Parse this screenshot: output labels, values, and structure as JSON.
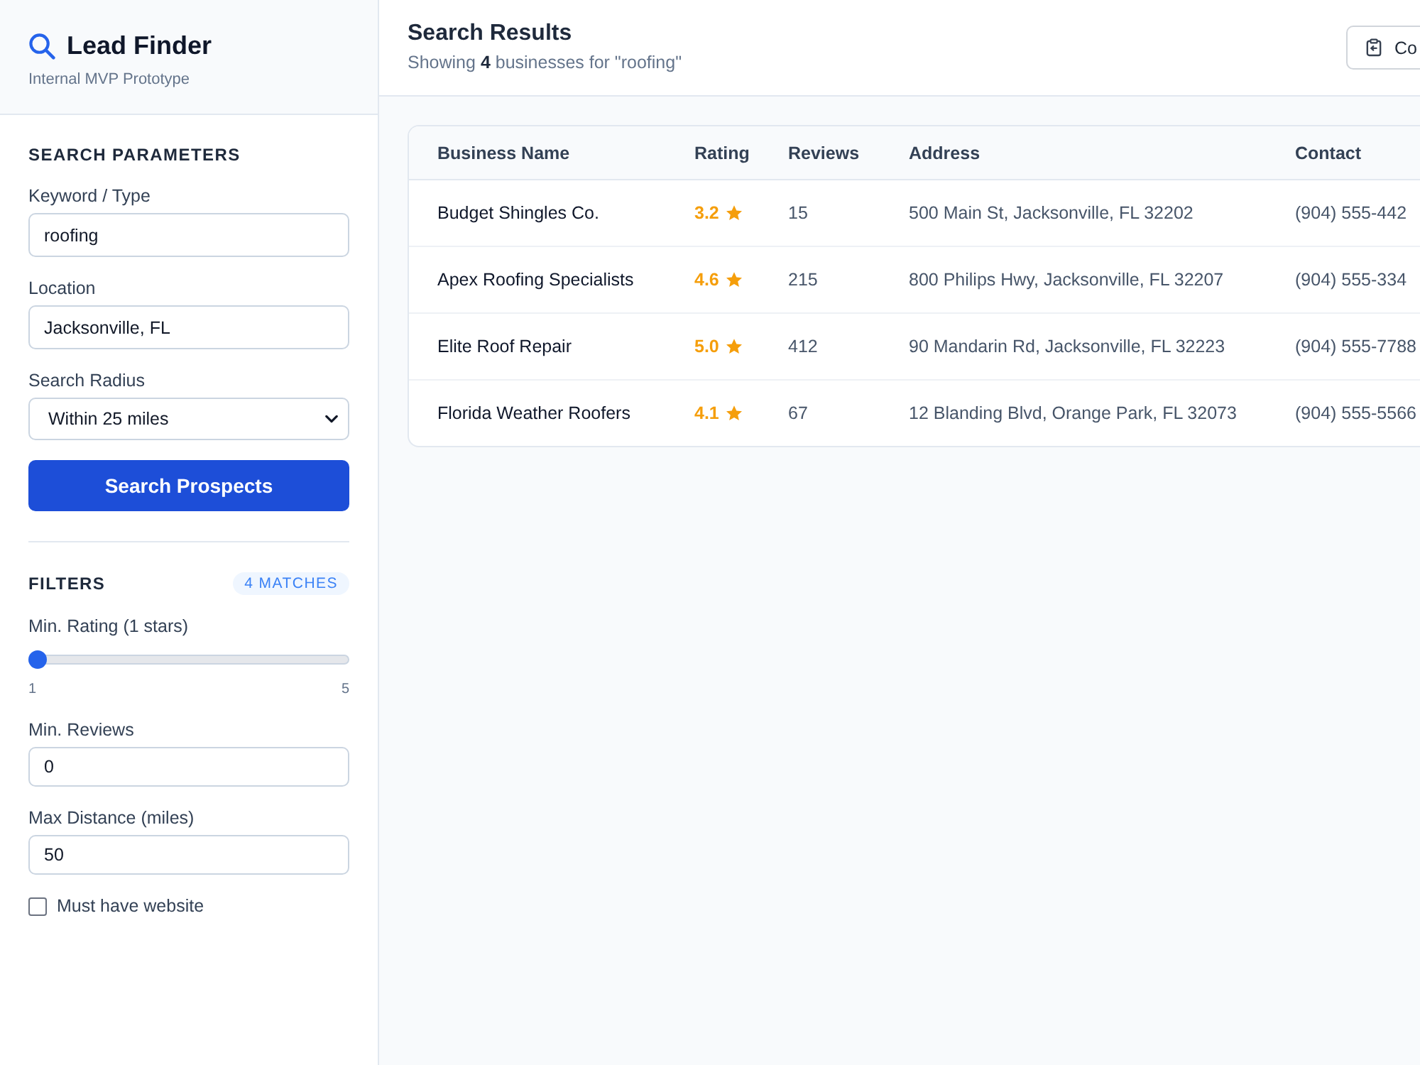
{
  "sidebar": {
    "title": "Lead Finder",
    "subtitle": "Internal MVP Prototype"
  },
  "search_parameters": {
    "heading": "SEARCH PARAMETERS",
    "fields": [
      {
        "kind": "text",
        "label": "Keyword / Type",
        "value": "roofing"
      },
      {
        "kind": "text",
        "label": "Location",
        "value": "Jacksonville, FL"
      },
      {
        "kind": "select",
        "label": "Search Radius",
        "value": "Within 25 miles"
      }
    ],
    "button": "Search Prospects"
  },
  "filters": {
    "heading": "FILTERS",
    "badge": "4 MATCHES",
    "slider": {
      "label": "Min. Rating (1 stars)",
      "level": 0,
      "min_label": "1",
      "max_label": "5"
    },
    "fields": [
      {
        "label": "Min. Reviews",
        "value": "0"
      },
      {
        "label": "Max Distance (miles)",
        "value": "50"
      }
    ],
    "checkbox": {
      "label": "Must have website",
      "checked": false
    }
  },
  "results": {
    "title": "Search Results",
    "summary": "Showing **4** businesses for \"roofing\"",
    "action_button": "Co"
  },
  "table": {
    "columns": [
      "Business Name",
      "Rating",
      "Reviews",
      "Address",
      "Contact"
    ],
    "rows": [
      {
        "name": "Budget Shingles Co.",
        "rating": "3.2",
        "reviews": "15",
        "address": "500 Main St, Jacksonville, FL 32202",
        "contact": "(904) 555-442"
      },
      {
        "name": "Apex Roofing Specialists",
        "rating": "4.6",
        "reviews": "215",
        "address": "800 Philips Hwy, Jacksonville, FL 32207",
        "contact": "(904) 555-334"
      },
      {
        "name": "Elite Roof Repair",
        "rating": "5.0",
        "reviews": "412",
        "address": "90 Mandarin Rd, Jacksonville, FL 32223",
        "contact": "(904) 555-7788"
      },
      {
        "name": "Florida Weather Roofers",
        "rating": "4.1",
        "reviews": "67",
        "address": "12 Blanding Blvd, Orange Park, FL 32073",
        "contact": "(904) 555-5566"
      }
    ]
  }
}
